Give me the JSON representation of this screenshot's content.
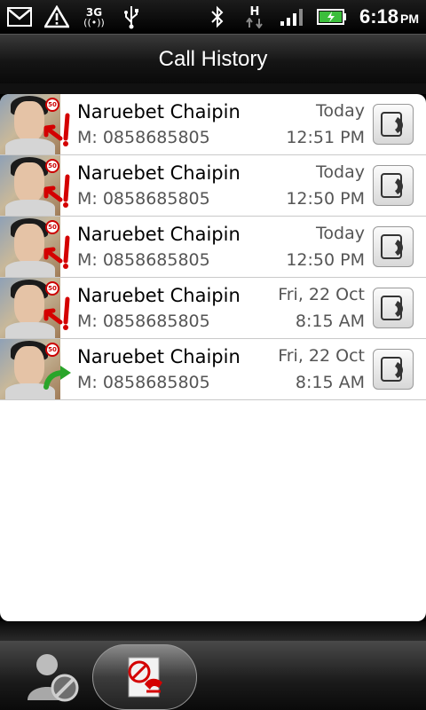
{
  "status_bar": {
    "time": "6:18",
    "ampm": "PM",
    "network_label": "3G",
    "data_label": "H",
    "icons": [
      "gmail-icon",
      "warning-icon",
      "3g-icon",
      "usb-icon",
      "bluetooth-icon",
      "h-data-icon",
      "signal-icon",
      "battery-icon"
    ]
  },
  "header": {
    "title": "Call History"
  },
  "calls": [
    {
      "name": "Naruebet Chaipin",
      "number": "M: 0858685805",
      "date": "Today",
      "time": "12:51 PM",
      "type": "missed"
    },
    {
      "name": "Naruebet Chaipin",
      "number": "M: 0858685805",
      "date": "Today",
      "time": "12:50 PM",
      "type": "missed"
    },
    {
      "name": "Naruebet Chaipin",
      "number": "M: 0858685805",
      "date": "Today",
      "time": "12:50 PM",
      "type": "missed"
    },
    {
      "name": "Naruebet Chaipin",
      "number": "M: 0858685805",
      "date": "Fri, 22 Oct",
      "time": "8:15 AM",
      "type": "missed"
    },
    {
      "name": "Naruebet Chaipin",
      "number": "M: 0858685805",
      "date": "Fri, 22 Oct",
      "time": "8:15 AM",
      "type": "outgoing"
    }
  ],
  "tabs": [
    {
      "name": "people",
      "icon": "people-icon",
      "active": false
    },
    {
      "name": "call-history",
      "icon": "call-history-icon",
      "active": true
    }
  ],
  "colors": {
    "missed": "#d40000",
    "outgoing": "#2aa52a"
  }
}
